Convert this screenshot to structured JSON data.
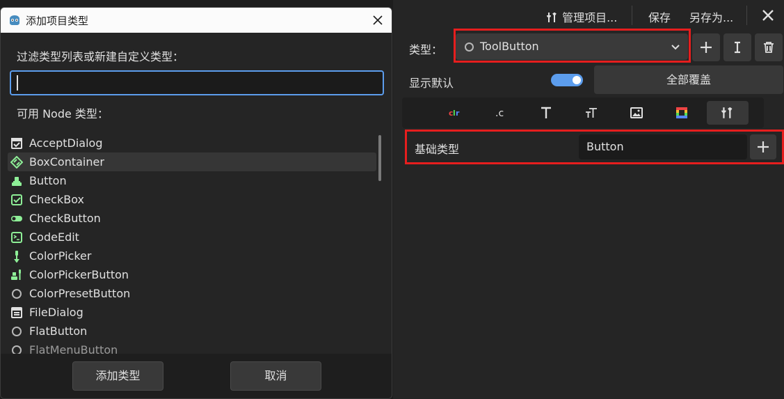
{
  "editor": {
    "topbar": {
      "manage_label": "管理项目...",
      "save_label": "保存",
      "save_as_label": "另存为..."
    },
    "type_label": "类型：",
    "type_value": "ToolButton",
    "show_default_label": "显示默认",
    "show_default_on": true,
    "override_all_label": "全部覆盖",
    "tabs": [
      "color-tab-icon",
      "constant-tab-icon",
      "font-tab-icon",
      "font-size-tab-icon",
      "icon-tab-icon",
      "stylebox-tab-icon",
      "type-settings-tab-icon"
    ],
    "active_tab": 6,
    "base_type_label": "基础类型",
    "base_type_value": "Button"
  },
  "dialog": {
    "title": "添加项目类型",
    "filter_label": "过滤类型列表或新建自定义类型：",
    "filter_value": "",
    "available_label": "可用 Node 类型：",
    "items": [
      {
        "label": "AcceptDialog",
        "icon": "dialog-icon"
      },
      {
        "label": "BoxContainer",
        "icon": "container-icon"
      },
      {
        "label": "Button",
        "icon": "button-icon"
      },
      {
        "label": "CheckBox",
        "icon": "checkbox-icon"
      },
      {
        "label": "CheckButton",
        "icon": "toggle-icon"
      },
      {
        "label": "CodeEdit",
        "icon": "code-edit-icon"
      },
      {
        "label": "ColorPicker",
        "icon": "color-picker-icon"
      },
      {
        "label": "ColorPickerButton",
        "icon": "color-picker-button-icon"
      },
      {
        "label": "ColorPresetButton",
        "icon": "circle-icon"
      },
      {
        "label": "FileDialog",
        "icon": "file-dialog-icon"
      },
      {
        "label": "FlatButton",
        "icon": "circle-icon"
      },
      {
        "label": "FlatMenuButton",
        "icon": "circle-icon"
      }
    ],
    "selected_index": 1,
    "add_button": "添加类型",
    "cancel_button": "取消"
  },
  "colors": {
    "accent": "#5c9ded",
    "node_green": "#8eef97",
    "highlight_red": "#e61e1e"
  }
}
